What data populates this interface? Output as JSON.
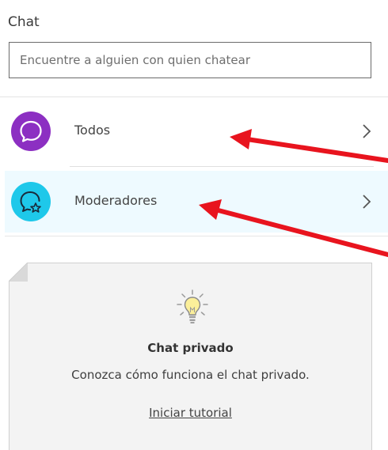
{
  "header": {
    "title": "Chat"
  },
  "search": {
    "placeholder": "Encuentre a alguien con quien chatear"
  },
  "channels": [
    {
      "label": "Todos",
      "icon": "chat-bubble-icon",
      "color": "#8c2fc2"
    },
    {
      "label": "Moderadores",
      "icon": "chat-bubble-star-icon",
      "color": "#1ec8ea",
      "highlight": "#eefaff"
    }
  ],
  "tutorial_card": {
    "icon": "lightbulb-icon",
    "title": "Chat privado",
    "text": "Conozca cómo funciona el chat privado.",
    "link": "Iniciar tutorial"
  },
  "annotations": {
    "arrow_color": "#e8141e"
  }
}
